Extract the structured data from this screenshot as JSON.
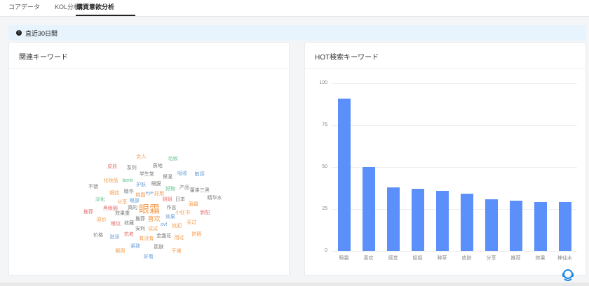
{
  "tabs": [
    {
      "label": "コアデータ",
      "active": false
    },
    {
      "label": "KOL分析",
      "active": false
    },
    {
      "label": "購買意欲分析",
      "active": true
    }
  ],
  "date_range": {
    "label": "直近30日間"
  },
  "related_keywords": {
    "title": "関連キーワード",
    "words": [
      {
        "text": "眼霜",
        "color": "#f59a4a",
        "size": 15
      },
      {
        "text": "喜欢",
        "color": "#f59a4a",
        "size": 9
      },
      {
        "text": "推荐",
        "color": "#7a7a7a",
        "size": 7
      },
      {
        "text": "真的",
        "color": "#7a7a7a",
        "size": 7
      },
      {
        "text": "眼部",
        "color": "#6aa0d8",
        "size": 7
      },
      {
        "text": "韩国",
        "color": "#f59a4a",
        "size": 7
      },
      {
        "text": "好用",
        "color": "#f59a4a",
        "size": 7
      },
      {
        "text": "姐姐",
        "color": "#e57373",
        "size": 7
      },
      {
        "text": "作息",
        "color": "#7a7a7a",
        "size": 7
      },
      {
        "text": "效果",
        "color": "#6aa0d8",
        "size": 7
      },
      {
        "text": "试试",
        "color": "#f59a4a",
        "size": 7
      },
      {
        "text": "安利",
        "color": "#7a7a7a",
        "size": 7
      },
      {
        "text": "收藏",
        "color": "#7a7a7a",
        "size": 7
      },
      {
        "text": "效果重",
        "color": "#7a7a7a",
        "size": 7
      },
      {
        "text": "分享",
        "color": "#f59a4a",
        "size": 7
      },
      {
        "text": "精华",
        "color": "#7a7a7a",
        "size": 7
      },
      {
        "text": "护肤",
        "color": "#6aa0d8",
        "size": 7
      },
      {
        "text": "眼膜",
        "color": "#7a7a7a",
        "size": 7
      },
      {
        "text": "好物",
        "color": "#5cbf8f",
        "size": 7
      },
      {
        "text": "日本",
        "color": "#7a7a7a",
        "size": 7
      },
      {
        "text": "小红书",
        "color": "#f59a4a",
        "size": 7
      },
      {
        "text": "抗初",
        "color": "#f59a4a",
        "size": 7
      },
      {
        "text": "金盏花",
        "color": "#7a7a7a",
        "size": 7
      },
      {
        "text": "有没有",
        "color": "#f59a4a",
        "size": 7
      },
      {
        "text": "抗老",
        "color": "#e57373",
        "size": 7
      },
      {
        "text": "眼纹",
        "color": "#e57373",
        "size": 7
      },
      {
        "text": "黑眼圈",
        "color": "#e57373",
        "size": 7
      },
      {
        "text": "细纹",
        "color": "#f59a4a",
        "size": 7
      },
      {
        "text": "eye",
        "color": "#6aa0d8",
        "size": 7
      },
      {
        "text": "ovf",
        "color": "#6aa0d8",
        "size": 7
      },
      {
        "text": "benk",
        "color": "#5cbf8f",
        "size": 7
      },
      {
        "text": "学生党",
        "color": "#7a7a7a",
        "size": 7
      },
      {
        "text": "保湿",
        "color": "#7a7a7a",
        "size": 7
      },
      {
        "text": "产品",
        "color": "#7a7a7a",
        "size": 7
      },
      {
        "text": "面霜",
        "color": "#f59a4a",
        "size": 7
      },
      {
        "text": "买过",
        "color": "#f59a4a",
        "size": 7
      },
      {
        "text": "用过",
        "color": "#f59a4a",
        "size": 7
      },
      {
        "text": "肌肤",
        "color": "#7a7a7a",
        "size": 7
      },
      {
        "text": "紧致",
        "color": "#6aa0d8",
        "size": 7
      },
      {
        "text": "滋润",
        "color": "#6aa0d8",
        "size": 7
      },
      {
        "text": "原价",
        "color": "#f59a4a",
        "size": 7
      },
      {
        "text": "淡化",
        "color": "#5cbf8f",
        "size": 7
      },
      {
        "text": "化妆品",
        "color": "#f59a4a",
        "size": 7
      },
      {
        "text": "系列",
        "color": "#7a7a7a",
        "size": 7
      },
      {
        "text": "质地",
        "color": "#7a7a7a",
        "size": 7
      },
      {
        "text": "吸收",
        "color": "#6aa0d8",
        "size": 7
      },
      {
        "text": "蕾弟三黑",
        "color": "#7a7a7a",
        "size": 7
      },
      {
        "text": "新配",
        "color": "#e57373",
        "size": 7
      },
      {
        "text": "防晒",
        "color": "#f59a4a",
        "size": 7
      },
      {
        "text": "干燥",
        "color": "#f59a4a",
        "size": 7
      },
      {
        "text": "好看",
        "color": "#6aa0d8",
        "size": 7
      },
      {
        "text": "眼周",
        "color": "#f59a4a",
        "size": 7
      },
      {
        "text": "价格",
        "color": "#7a7a7a",
        "size": 7
      },
      {
        "text": "推荐",
        "color": "#e57373",
        "size": 7
      },
      {
        "text": "不错",
        "color": "#7a7a7a",
        "size": 7
      },
      {
        "text": "皮肤",
        "color": "#e57373",
        "size": 7
      },
      {
        "text": "女人",
        "color": "#f59a4a",
        "size": 7
      },
      {
        "text": "功效",
        "color": "#5cbf8f",
        "size": 7
      },
      {
        "text": "敏感",
        "color": "#6aa0d8",
        "size": 7
      },
      {
        "text": "精华水",
        "color": "#7a7a7a",
        "size": 7
      }
    ]
  },
  "hot_keywords": {
    "title": "HOT検索キーワード",
    "chart_data": {
      "type": "bar",
      "categories": [
        "眼霜",
        "喜欢",
        "感觉",
        "姐姐",
        "种草",
        "皮肤",
        "分享",
        "推荐",
        "效果",
        "神仙水"
      ],
      "values": [
        91,
        50,
        38,
        37,
        36,
        34,
        31,
        30,
        29,
        29
      ],
      "ylim": [
        0,
        100
      ],
      "yticks": [
        0,
        25,
        50,
        75,
        100
      ],
      "color": "#5b8ff9"
    }
  }
}
